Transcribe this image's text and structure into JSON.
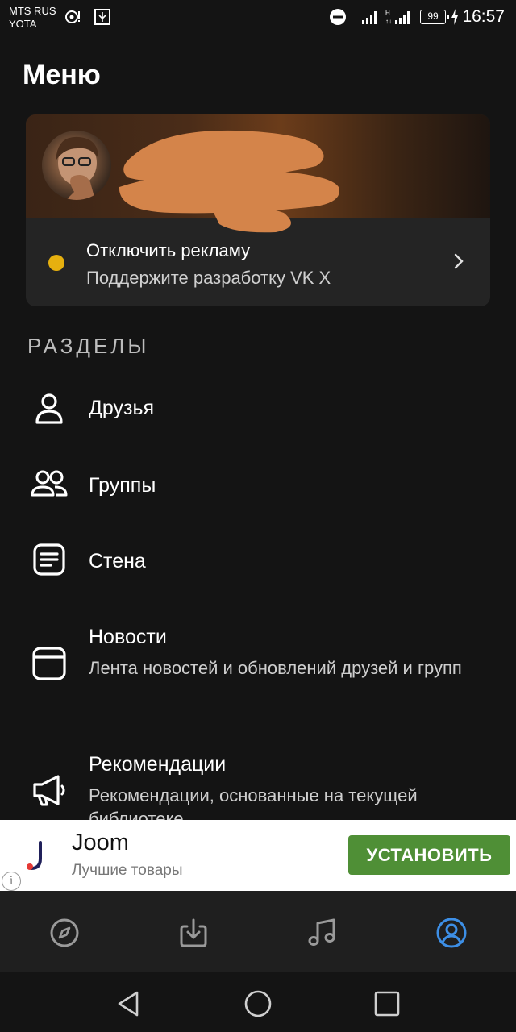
{
  "status_bar": {
    "carrier_line1": "MTS RUS",
    "carrier_line2": "YOTA",
    "battery": "99",
    "time": "16:57"
  },
  "page_title": "Меню",
  "profile": {
    "ads_title": "Отключить рекламу",
    "ads_subtitle": "Поддержите разработку VK X",
    "dot_color": "#e6b00f"
  },
  "sections_header": "РАЗДЕЛЫ",
  "menu": {
    "friends": {
      "label": "Друзья",
      "icon": "person-icon"
    },
    "groups": {
      "label": "Группы",
      "icon": "people-icon"
    },
    "wall": {
      "label": "Стена",
      "icon": "wall-icon"
    },
    "news": {
      "label": "Новости",
      "subtitle": "Лента новостей и обновлений друзей и групп",
      "icon": "window-icon"
    },
    "recommendations": {
      "label": "Рекомендации",
      "subtitle": "Рекомендации, основанные на текущей библиотеке",
      "icon": "megaphone-icon"
    }
  },
  "ad": {
    "title": "Joom",
    "subtitle": "Лучшие товары",
    "button": "УСТАНОВИТЬ",
    "button_color": "#4f8f36"
  },
  "bottom_nav": [
    {
      "name": "explore",
      "icon": "compass-icon",
      "active": false
    },
    {
      "name": "downloads",
      "icon": "download-icon",
      "active": false
    },
    {
      "name": "music",
      "icon": "music-note-icon",
      "active": false
    },
    {
      "name": "profile",
      "icon": "profile-circle-icon",
      "active": true
    }
  ],
  "colors": {
    "accent": "#3d8fe6",
    "background": "#141414"
  }
}
